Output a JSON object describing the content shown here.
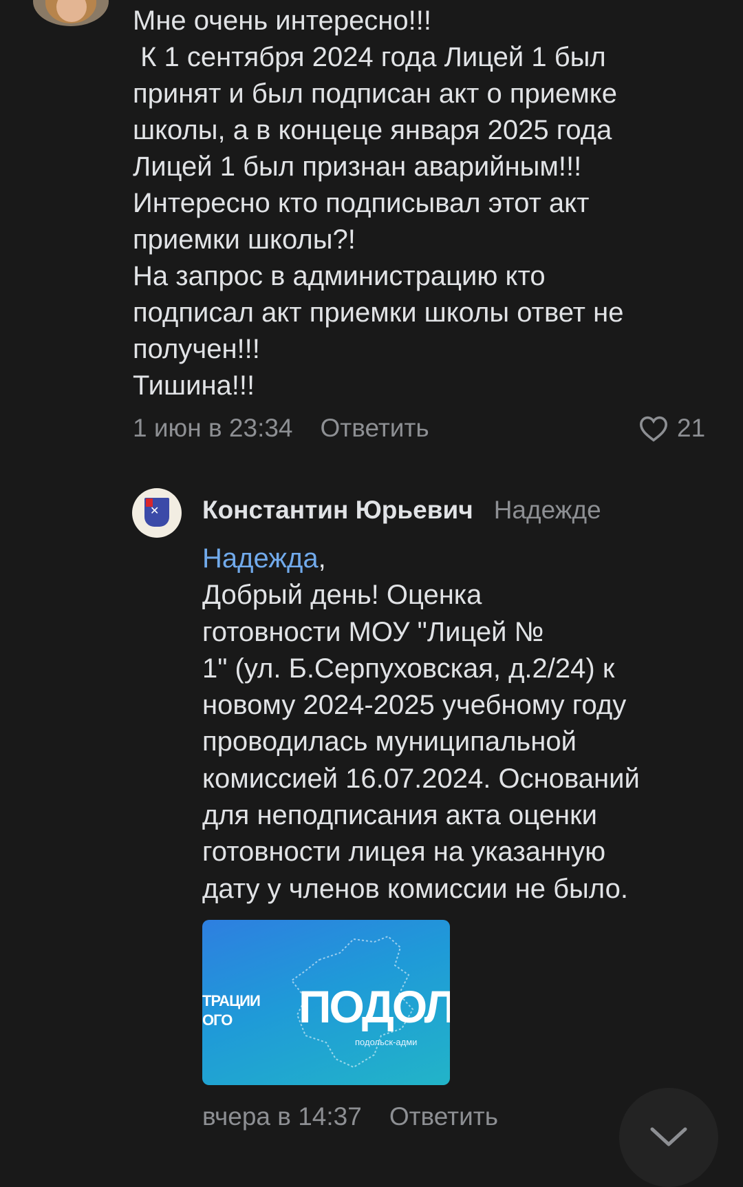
{
  "comment1": {
    "text": "Мне очень интересно!!!\n К 1 сентября 2024 года Лицей 1 был\nпринят и был подписан акт о приемке\nшколы, а в концеце января 2025 года\nЛицей 1 был признан аварийным!!!\nИнтересно кто подписывал этот акт\nприемки школы?!\nНа запрос в администрацию кто\nподписал акт приемки школы ответ не\nполучен!!!\nТишина!!!",
    "date": "1 июн в 23:34",
    "reply_label": "Ответить",
    "likes": "21"
  },
  "comment2": {
    "author": "Константин Юрьевич",
    "reply_to": "Надежде",
    "mention": "Надежда",
    "mention_suffix": ",",
    "text": "Добрый день! Оценка\nготовности МОУ \"Лицей №\n1\" (ул. Б.Серпуховская, д.2/24) к\nновому 2024-2025 учебному году\nпроводилась муниципальной\nкомиссией 16.07.2024. Оснований\nдля неподписания акта оценки\nготовности лицея на указанную\nдату у членов комиссии не было.",
    "attachment": {
      "left_text_line1": "ТРАЦИИ",
      "left_text_line2": "ОГО",
      "big_text": "ПОДОЛ",
      "small_text": "подольск-адми"
    },
    "date": "вчера в 14:37",
    "reply_label": "Ответить"
  },
  "colors": {
    "background": "#191919",
    "text": "#e1e3e6",
    "secondary": "#8d8f93",
    "link": "#71aaeb"
  },
  "icons": {
    "like": "heart-outline-icon",
    "scroll": "chevron-down-icon"
  }
}
